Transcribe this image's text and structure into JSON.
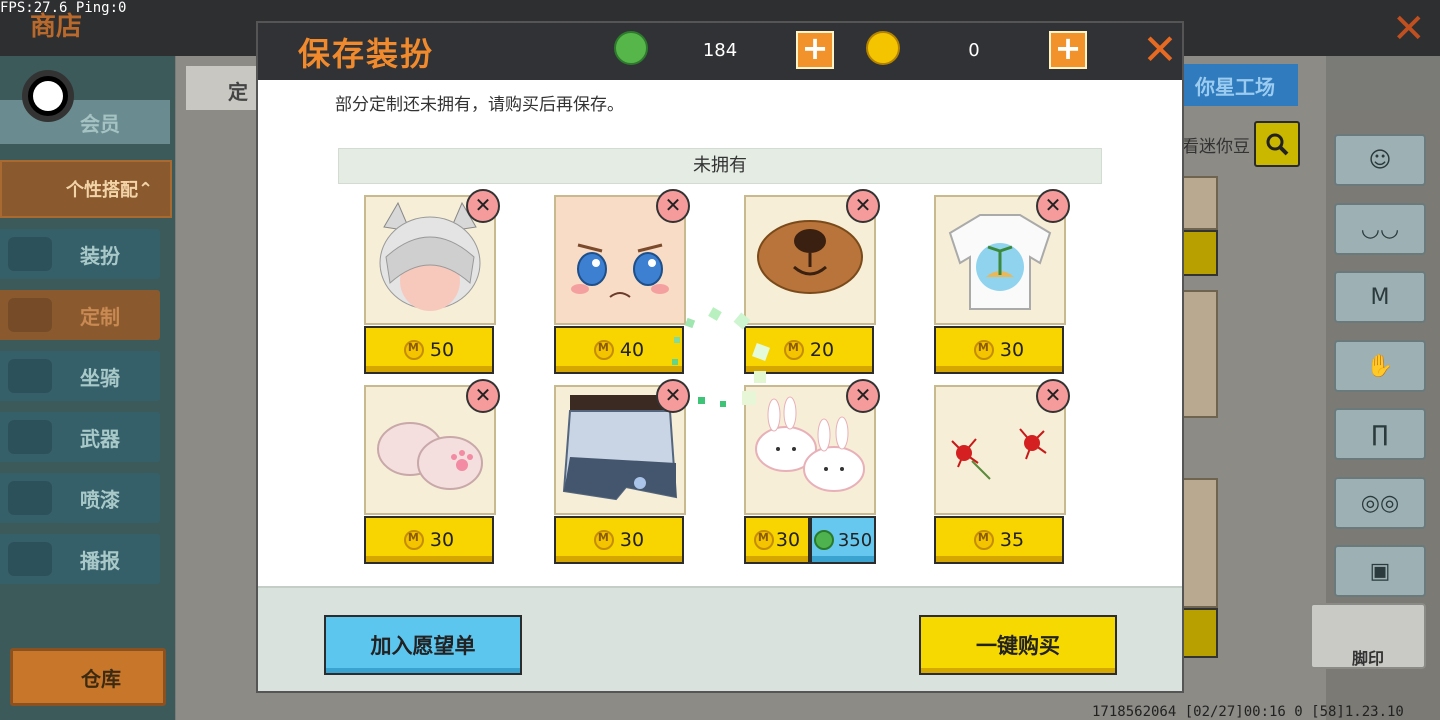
{
  "status": {
    "fps": "FPS:27.6",
    "ping": "Ping:0"
  },
  "background": {
    "shop_title": "商店",
    "sidebar": {
      "member": "会员",
      "personal": "个性搭配",
      "items": [
        "装扮",
        "定制",
        "坐骑",
        "武器",
        "喷漆",
        "播报"
      ],
      "active": "定制",
      "warehouse": "仓库"
    },
    "tab_left": "定",
    "tab_right": "你星工场",
    "search_hint": "看迷你豆",
    "paw_label": "脚印",
    "footer": "1718562064   [02/27]00:16 0  [58]1.23.10"
  },
  "dialog": {
    "title": "保存装扮",
    "gems": "184",
    "coins": "0",
    "notice": "部分定制还未拥有，请购买后再保存。",
    "section": "未拥有",
    "items": [
      {
        "name": "cat-hair",
        "price": "50"
      },
      {
        "name": "face",
        "price": "40"
      },
      {
        "name": "bear-nose",
        "price": "20"
      },
      {
        "name": "tshirt",
        "price": "30"
      },
      {
        "name": "paw-gloves",
        "price": "30"
      },
      {
        "name": "skirt",
        "price": "30"
      },
      {
        "name": "bunny-slippers",
        "price": "30",
        "gem_price": "350"
      },
      {
        "name": "red-flowers",
        "price": "35"
      }
    ],
    "wishlist_button": "加入愿望单",
    "buy_button": "一键购买"
  },
  "colors": {
    "accent": "#f08a2c",
    "buy": "#f5d900",
    "wish": "#5cc6ef"
  }
}
